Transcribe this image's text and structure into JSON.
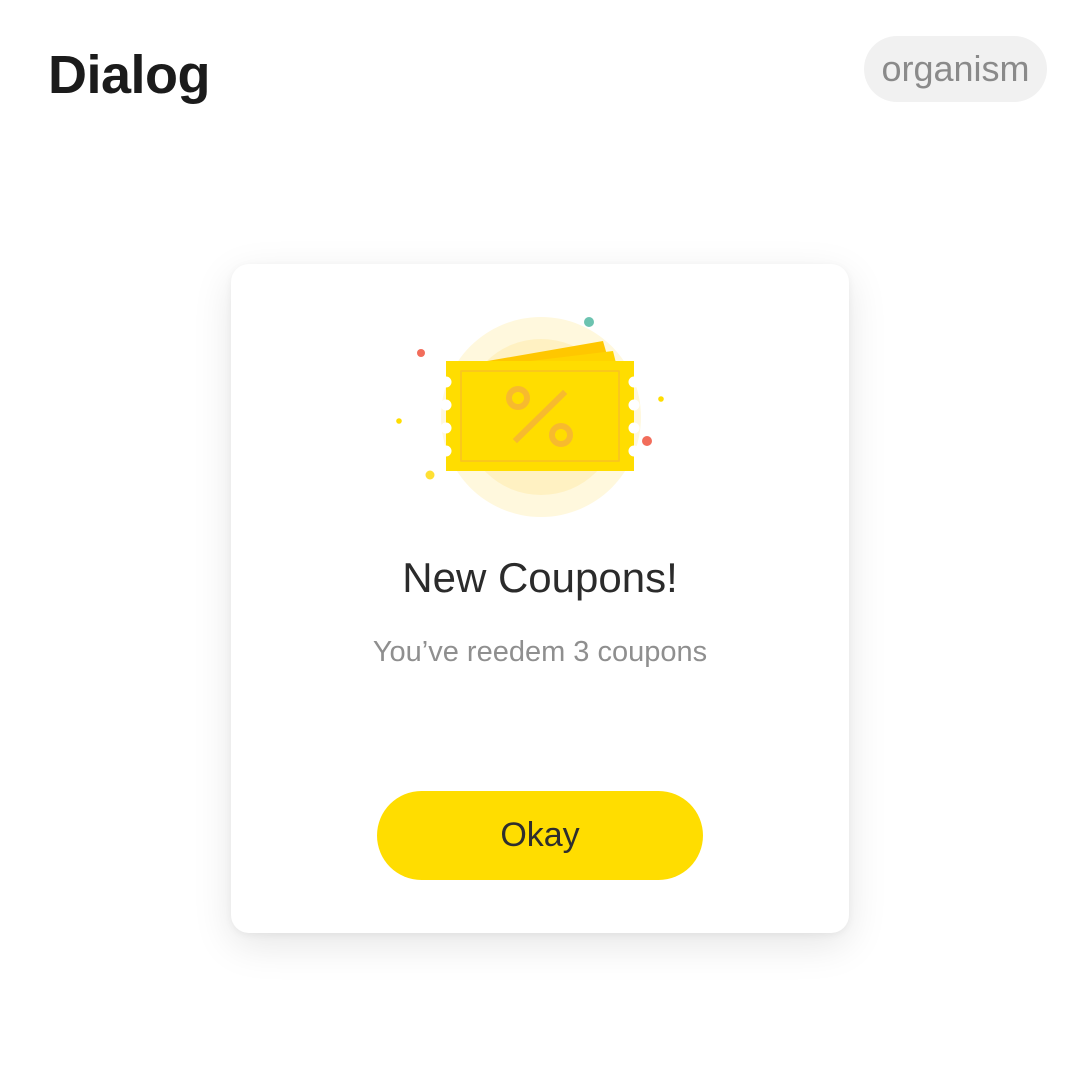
{
  "header": {
    "title": "Dialog",
    "category_chip": "organism"
  },
  "dialog": {
    "illustration_icon": "coupon-ticket-icon",
    "title": "New Coupons!",
    "subtitle": "You’ve reedem 3 coupons",
    "primary_button_label": "Okay"
  },
  "colors": {
    "accent": "#FFDD00",
    "ticket_primary": "#FFDD00",
    "ticket_secondary": "#FFC700",
    "glow": "#FFF6D6",
    "confetti_red": "#F26D5B",
    "confetti_teal": "#6CC3B0",
    "confetti_yellow": "#FFE033"
  }
}
